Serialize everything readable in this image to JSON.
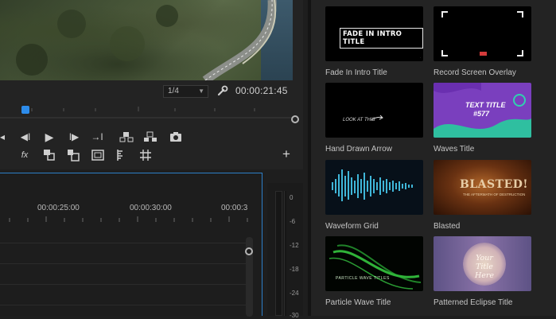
{
  "program_monitor": {
    "resolution": "1/4",
    "timecode": "00:00:21:45"
  },
  "timeline": {
    "time_labels": [
      "00:00:25:00",
      "00:00:30:00",
      "00:00:3"
    ]
  },
  "audio_meter": {
    "scale": [
      "0",
      "-6",
      "-12",
      "-18",
      "-24",
      "-30"
    ]
  },
  "library": {
    "items": [
      {
        "label": "Fade In Intro Title",
        "thumb_text": "FADE IN INTRO TITLE"
      },
      {
        "label": "Record Screen Overlay"
      },
      {
        "label": "Hand Drawn Arrow",
        "thumb_text": "LOOK AT THIS"
      },
      {
        "label": "Waves Title",
        "thumb_text_1": "TEXT TITLE",
        "thumb_text_2": "#577"
      },
      {
        "label": "Waveform Grid"
      },
      {
        "label": "Blasted",
        "thumb_text": "BLASTED!",
        "thumb_subtext": "THE AFTERMATH OF DESTRUCTION"
      },
      {
        "label": "Particle Wave Title",
        "thumb_text": "PARTICLE WAVE TITLES"
      },
      {
        "label": "Patterned Eclipse Title",
        "thumb_text": "Your Title Here"
      }
    ]
  },
  "colors": {
    "accent": "#2d8ceb",
    "panel_border_active": "#2d7fc8",
    "background": "#1e1e1e"
  }
}
